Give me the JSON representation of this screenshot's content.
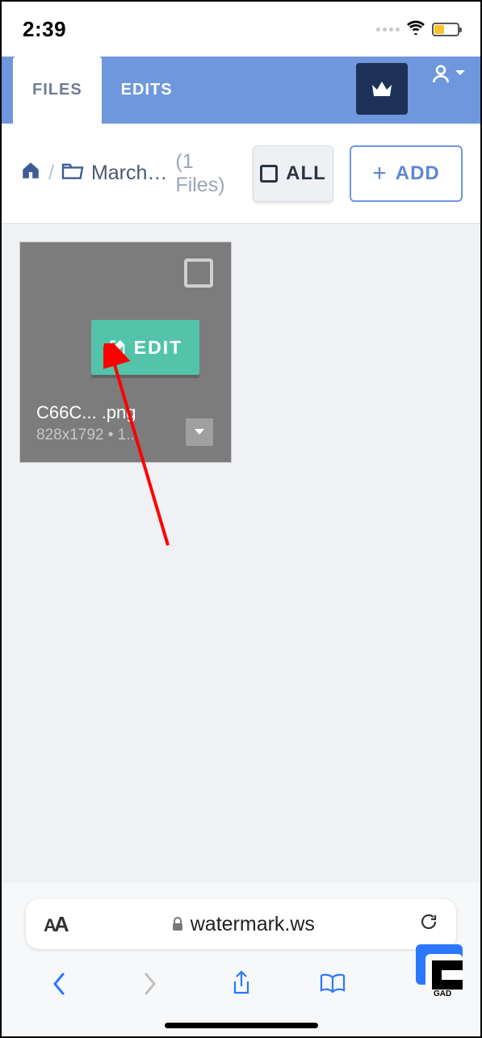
{
  "status": {
    "time": "2:39"
  },
  "tabs": {
    "files": "FILES",
    "edits": "EDITS"
  },
  "breadcrumb": {
    "folder": "March ...",
    "count": "(1 Files)"
  },
  "toolbar": {
    "all": "ALL",
    "add": "ADD"
  },
  "thumb": {
    "edit": "EDIT",
    "filename": "C66C... .png",
    "meta": "828x1792 • 1..."
  },
  "browser": {
    "url": "watermark.ws",
    "aa_small": "A",
    "aa_big": "A"
  }
}
